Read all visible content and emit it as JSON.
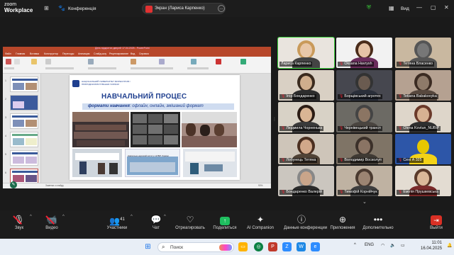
{
  "app": {
    "brand_line1": "zoom",
    "brand_line2": "Workplace",
    "conference_label": "Конференція",
    "sharing_label": "Экран (Лариса Карпенко)",
    "view_label": "Вид"
  },
  "slide": {
    "university": "НАЦІОНАЛЬНИЙ УНІВЕРСИТЕТ БІОРЕСУРСІВ І ПРИРОДОКОРИСТУВАННЯ УКРАЇНИ",
    "heading": "НАВЧАЛЬНИЙ ПРОЦЕС",
    "subtitle_bold": "формати навчання",
    "subtitle_rest": ": офлайн, онлайн, змішаний формат",
    "caption": "Навчально-науковий інститут НУБіП України"
  },
  "ppt": {
    "title": "День відкритих дверей 17.04.2025 - PowerPoint",
    "menu": [
      "Файл",
      "Главная",
      "Вставка",
      "Конструктор",
      "Переходы",
      "Анимация",
      "Слайд-шоу",
      "Рецензирование",
      "Вид",
      "Справка"
    ],
    "status_notes": "Заметки к слайду",
    "status_zoom": "90%"
  },
  "participants": [
    {
      "name": "Лариса Карпенко",
      "muted": false,
      "speaking": true
    },
    {
      "name": "Oksana Havrysh",
      "muted": true,
      "speaking": false
    },
    {
      "name": "Тетяна Власенко",
      "muted": true,
      "speaking": false
    },
    {
      "name": "Ігор Бондаренко",
      "muted": true,
      "speaking": false
    },
    {
      "name": "Борщівський агротех",
      "muted": true,
      "speaking": false
    },
    {
      "name": "Tetiana Babakovyka",
      "muted": true,
      "speaking": false
    },
    {
      "name": "Людмила Чорненька",
      "muted": true,
      "speaking": false
    },
    {
      "name": "Чернівецький трансп",
      "muted": true,
      "speaking": false
    },
    {
      "name": "Olena Kovtun_NUBiP",
      "muted": true,
      "speaking": false
    },
    {
      "name": "Лобунець Тетяна",
      "muted": true,
      "speaking": false
    },
    {
      "name": "Володимир Восколуп",
      "muted": true,
      "speaking": false
    },
    {
      "name": "Сені А 325",
      "muted": true,
      "speaking": false
    },
    {
      "name": "Бондаренко Валерій",
      "muted": true,
      "speaking": false
    },
    {
      "name": "Тимофій Корнійчук",
      "muted": true,
      "speaking": false
    },
    {
      "name": "Емілія Прушкевська",
      "muted": true,
      "speaking": false
    }
  ],
  "toolbar": {
    "audio": "Звук",
    "video": "Видео",
    "participants": "Участники",
    "participants_count": "41",
    "chat": "Чат",
    "react": "Отреагировать",
    "share": "Поделиться",
    "companion": "AI Companion",
    "conf_data": "Данные конференции",
    "apps": "Приложения",
    "more": "Дополнительно",
    "leave": "Выйти"
  },
  "taskbar": {
    "search_placeholder": "Поиск",
    "lang": "ENG",
    "time": "11:01",
    "date": "16.04.2025"
  },
  "colors": {
    "ppt_accent": "#b7472a",
    "slide_blue": "#1f3f8f",
    "share_green": "#1fbf5f",
    "leave_red": "#d93025",
    "speaker_outline": "#3ad13a"
  }
}
